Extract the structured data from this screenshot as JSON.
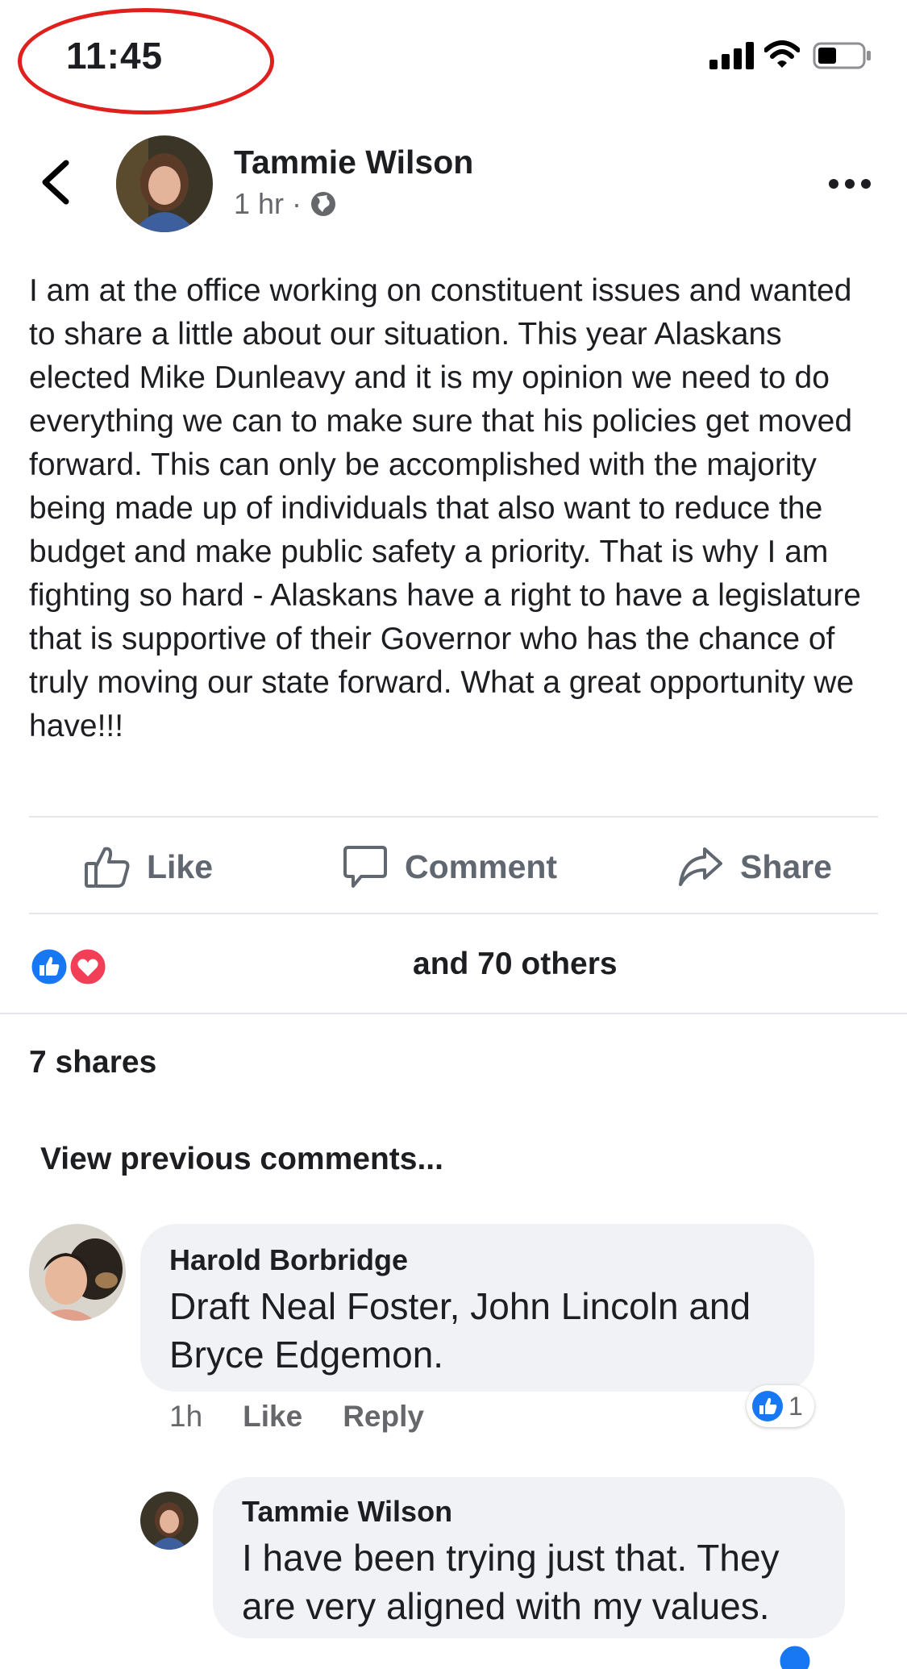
{
  "status_bar": {
    "time": "11:45"
  },
  "post": {
    "author": "Tammie Wilson",
    "time_ago": "1 hr",
    "separator": "·",
    "text": "I am at the office working on constituent issues and wanted to share a little about our situation. This year Alaskans elected Mike Dunleavy and it is my opinion we need to do everything we can to make sure that his policies get moved forward. This can only be accomplished with the majority being made up of individuals that also want to reduce the budget and make public safety a priority. That is why I am fighting so hard - Alaskans have a right to have a legislature that is supportive of their Governor  who has the chance of truly moving our state forward. What a great opportunity we have!!!"
  },
  "actions": {
    "like": "Like",
    "comment": "Comment",
    "share": "Share"
  },
  "reactions": {
    "summary": "and 70 others"
  },
  "shares": "7 shares",
  "view_previous": "View previous comments...",
  "comments": [
    {
      "author": "Harold Borbridge",
      "text": "Draft Neal Foster, John Lincoln and Bryce Edgemon.",
      "time": "1h",
      "like": "Like",
      "reply": "Reply",
      "reaction_count": "1"
    }
  ],
  "reply": {
    "author": "Tammie Wilson",
    "text": "I have been trying just that. They are very aligned with my values."
  },
  "colors": {
    "facebook_blue": "#1877f2",
    "love_red": "#f33e58",
    "annotation_red": "#e0201d",
    "bubble_gray": "#f0f2f5"
  },
  "icons": [
    "signal-icon",
    "wifi-icon",
    "battery-icon",
    "back-chevron-icon",
    "more-dots-icon",
    "globe-icon",
    "thumbs-up-icon",
    "comment-bubble-icon",
    "share-arrow-icon",
    "like-reaction-icon",
    "love-reaction-icon"
  ]
}
